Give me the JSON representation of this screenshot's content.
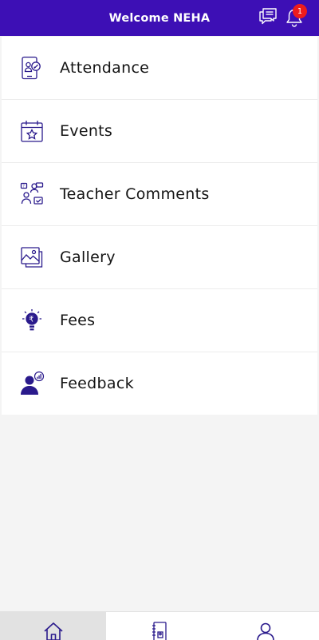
{
  "header": {
    "title": "Welcome NEHA",
    "notification_count": "1",
    "chat_icon": "chat-bubbles-icon",
    "bell_icon": "bell-icon"
  },
  "menu": {
    "items": [
      {
        "label": "Attendance",
        "icon": "attendance-tablet-icon"
      },
      {
        "label": "Events",
        "icon": "calendar-star-icon"
      },
      {
        "label": "Teacher Comments",
        "icon": "teacher-comments-icon"
      },
      {
        "label": "Gallery",
        "icon": "gallery-image-icon"
      },
      {
        "label": "Fees",
        "icon": "rupee-bulb-icon"
      },
      {
        "label": "Feedback",
        "icon": "feedback-person-icon"
      }
    ]
  },
  "bottom_nav": {
    "items": [
      {
        "icon": "home-icon",
        "active": true
      },
      {
        "icon": "contact-book-icon",
        "active": false
      },
      {
        "icon": "profile-icon",
        "active": false
      }
    ]
  },
  "colors": {
    "primary": "#3d0fb5",
    "icon": "#2a1a8c",
    "badge": "#ee1c1c",
    "background": "#f4f4f4"
  }
}
